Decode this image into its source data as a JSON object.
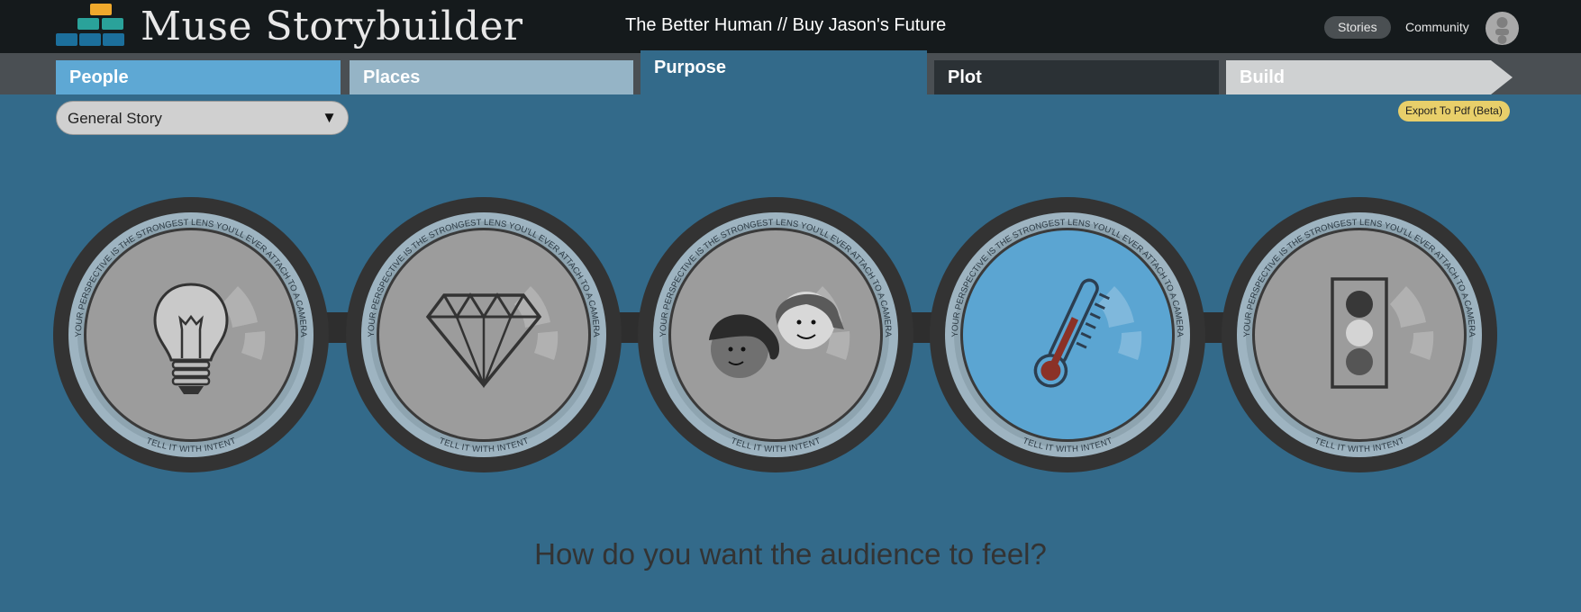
{
  "app": {
    "title": "Muse Storybuilder"
  },
  "story": {
    "title": "The Better Human // Buy Jason's Future"
  },
  "nav": {
    "stories": "Stories",
    "community": "Community"
  },
  "tabs": {
    "people": "People",
    "places": "Places",
    "purpose": "Purpose",
    "plot": "Plot",
    "build": "Build"
  },
  "story_type": {
    "selected": "General Story"
  },
  "export": {
    "label": "Export To Pdf (Beta)"
  },
  "wheel": {
    "ring_top_text": "YOUR PERSPECTIVE IS THE STRONGEST LENS YOU'LL EVER ATTACH TO A CAMERA",
    "ring_bottom_text": "TELL IT WITH INTENT",
    "items": [
      {
        "icon": "lightbulb-icon",
        "active": false
      },
      {
        "icon": "diamond-icon",
        "active": false
      },
      {
        "icon": "audience-faces-icon",
        "active": false
      },
      {
        "icon": "thermometer-icon",
        "active": true
      },
      {
        "icon": "traffic-light-icon",
        "active": false
      }
    ]
  },
  "question": "How do you want the audience to feel?",
  "colors": {
    "active_disc": "#5ba5d2",
    "inactive_disc": "#9c9c9c",
    "export_button": "#e8cf6a",
    "thermometer_fill": "#8b3127"
  }
}
